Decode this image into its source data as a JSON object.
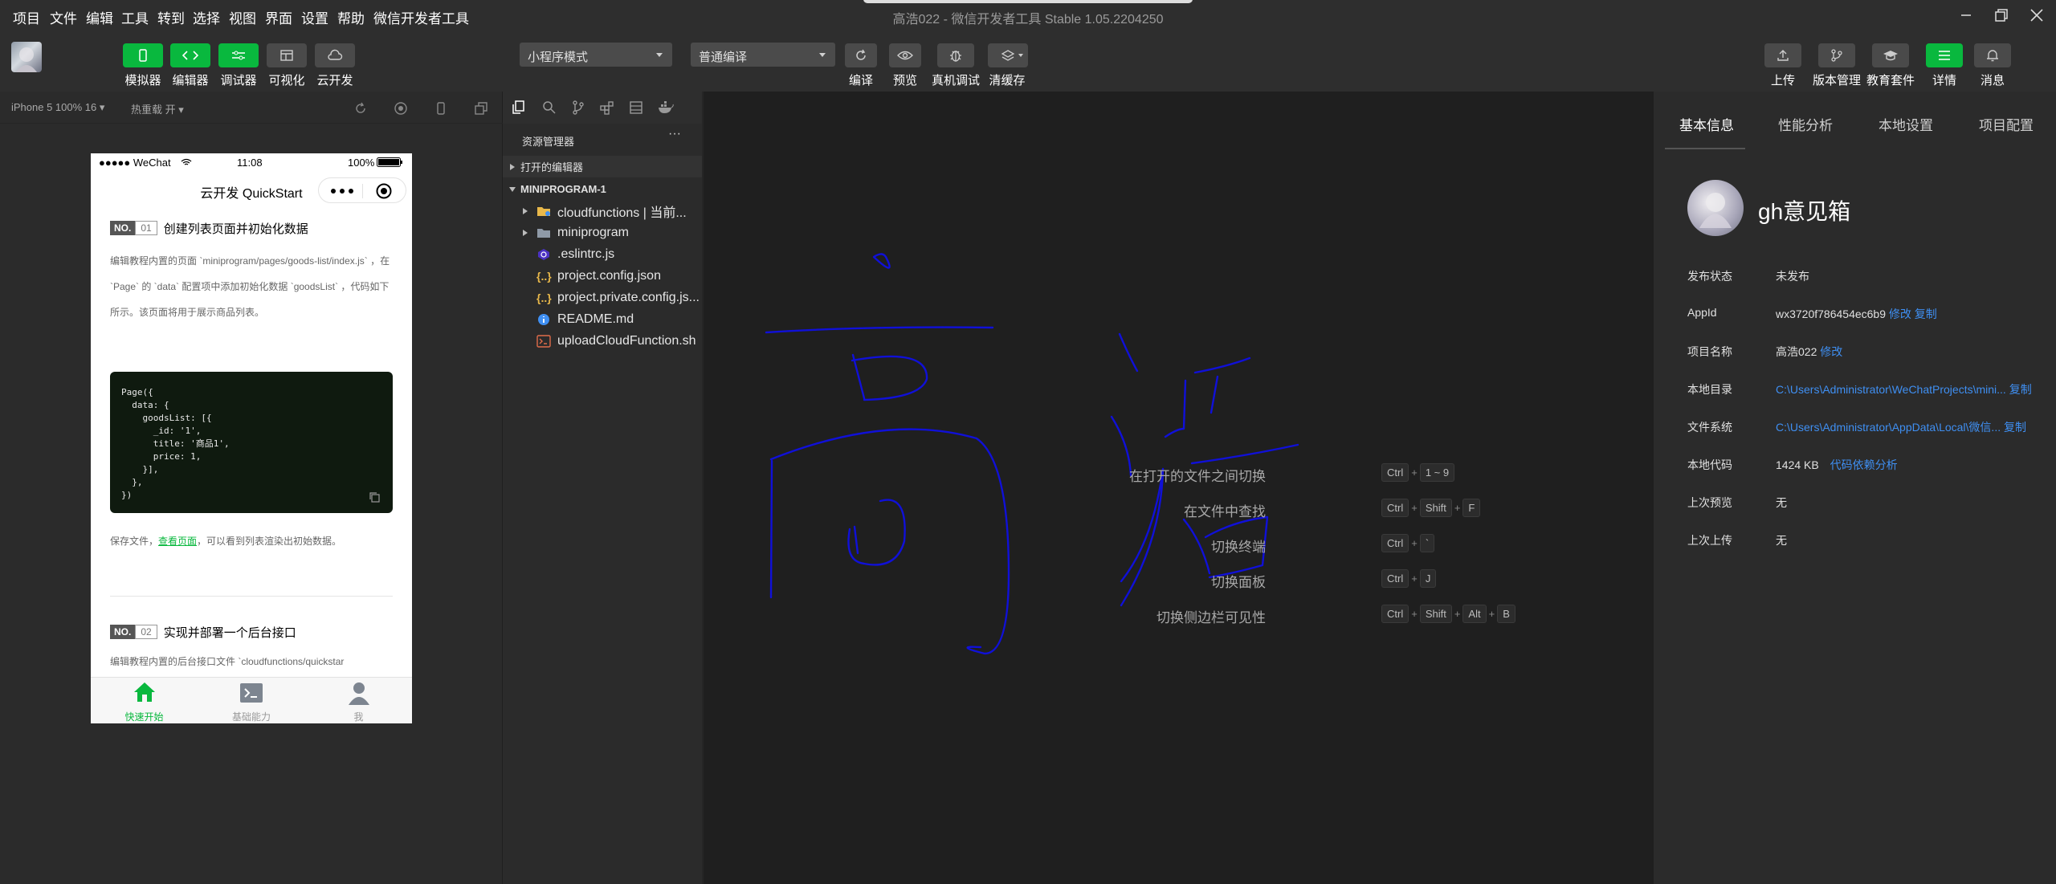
{
  "menu": [
    "项目",
    "文件",
    "编辑",
    "工具",
    "转到",
    "选择",
    "视图",
    "界面",
    "设置",
    "帮助",
    "微信开发者工具"
  ],
  "window_title": "高浩022 - 微信开发者工具 Stable 1.05.2204250",
  "toolbar": {
    "left_buttons": [
      {
        "label": "模拟器",
        "icon": "phone-icon"
      },
      {
        "label": "编辑器",
        "icon": "code-icon"
      },
      {
        "label": "调试器",
        "icon": "debug-icon"
      },
      {
        "label": "可视化",
        "icon": "layout-icon"
      },
      {
        "label": "云开发",
        "icon": "cloud-icon"
      }
    ],
    "mode_select": "小程序模式",
    "compile_select": "普通编译",
    "mid_buttons": [
      {
        "label": "编译",
        "icon": "refresh-icon"
      },
      {
        "label": "预览",
        "icon": "eye-icon"
      },
      {
        "label": "真机调试",
        "icon": "bug-icon"
      },
      {
        "label": "清缓存",
        "icon": "layers-icon"
      }
    ],
    "right_buttons": [
      {
        "label": "上传",
        "icon": "upload-icon"
      },
      {
        "label": "版本管理",
        "icon": "branch-icon"
      },
      {
        "label": "教育套件",
        "icon": "graduation-icon"
      },
      {
        "label": "详情",
        "icon": "menu-icon"
      },
      {
        "label": "消息",
        "icon": "bell-icon"
      }
    ]
  },
  "simulator": {
    "device": "iPhone 5 100% 16 ▾",
    "hot_reload": "热重载 开 ▾",
    "status_carrier": "●●●●● WeChat",
    "status_time": "11:08",
    "status_battery": "100%",
    "nav_title": "云开发 QuickStart",
    "section1_no": "NO.",
    "section1_num": "01",
    "section1_title": "创建列表页面并初始化数据",
    "section1_text": "编辑教程内置的页面 `miniprogram/pages/goods-list/index.js` ，在 `Page` 的 `data` 配置项中添加初始化数据 `goodsList` ，代码如下所示。该页面将用于展示商品列表。",
    "code": "Page({\n  data: {\n    goodsList: [{\n      _id: '1',\n      title: '商品1',\n      price: 1,\n    }],\n  },\n})",
    "section1_after_prefix": "保存文件，",
    "section1_after_link": "查看页面",
    "section1_after_suffix": "，可以看到列表渲染出初始数据。",
    "section2_no": "NO.",
    "section2_num": "02",
    "section2_title": "实现并部署一个后台接口",
    "section2_text": "编辑教程内置的后台接口文件 `cloudfunctions/quickstar",
    "tabs": [
      "快速开始",
      "基础能力",
      "我"
    ]
  },
  "explorer": {
    "title": "资源管理器",
    "more": "···",
    "open_editors": "打开的编辑器",
    "project": "MINIPROGRAM-1",
    "items": [
      {
        "name": "cloudfunctions | 当前...",
        "icon": "folder-icon",
        "type": "folder"
      },
      {
        "name": "miniprogram",
        "icon": "folder-icon",
        "type": "folder"
      },
      {
        "name": ".eslintrc.js",
        "icon": "eslint-icon",
        "type": "file"
      },
      {
        "name": "project.config.json",
        "icon": "json-icon",
        "type": "file"
      },
      {
        "name": "project.private.config.js...",
        "icon": "json-icon",
        "type": "file"
      },
      {
        "name": "README.md",
        "icon": "info-icon",
        "type": "file"
      },
      {
        "name": "uploadCloudFunction.sh",
        "icon": "shell-icon",
        "type": "file"
      }
    ]
  },
  "editor": {
    "shortcuts": [
      {
        "label": "在打开的文件之间切换",
        "keys": [
          "Ctrl",
          "1 ~ 9"
        ]
      },
      {
        "label": "在文件中查找",
        "keys": [
          "Ctrl",
          "Shift",
          "F"
        ]
      },
      {
        "label": "切换终端",
        "keys": [
          "Ctrl",
          "`"
        ]
      },
      {
        "label": "切换面板",
        "keys": [
          "Ctrl",
          "J"
        ]
      },
      {
        "label": "切换侧边栏可见性",
        "keys": [
          "Ctrl",
          "Shift",
          "Alt",
          "B"
        ]
      }
    ],
    "handwriting_color": "#1010d8"
  },
  "details": {
    "tabs": [
      "基本信息",
      "性能分析",
      "本地设置",
      "项目配置"
    ],
    "app_name": "gh意见箱",
    "rows": [
      {
        "label": "发布状态",
        "value": "未发布",
        "links": []
      },
      {
        "label": "AppId",
        "value": "wx3720f786454ec6b9",
        "links": [
          "修改",
          "复制"
        ]
      },
      {
        "label": "项目名称",
        "value": "高浩022",
        "links": [
          "修改"
        ]
      },
      {
        "label": "本地目录",
        "value": "C:\\Users\\Administrator\\WeChatProjects\\mini...",
        "links": [
          "复制"
        ],
        "value_is_link": true
      },
      {
        "label": "文件系统",
        "value": "C:\\Users\\Administrator\\AppData\\Local\\微信...",
        "links": [
          "复制"
        ],
        "value_is_link": true
      },
      {
        "label": "本地代码",
        "value": "1424 KB",
        "links": [
          "代码依赖分析"
        ]
      },
      {
        "label": "上次预览",
        "value": "无",
        "links": []
      },
      {
        "label": "上次上传",
        "value": "无",
        "links": []
      }
    ]
  },
  "colors": {
    "accent_green": "#09b83e",
    "link_blue": "#3f8ff2"
  }
}
